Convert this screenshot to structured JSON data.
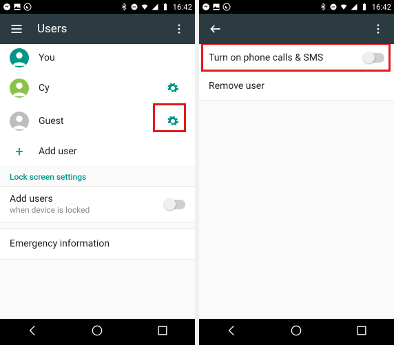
{
  "status": {
    "time": "16:42"
  },
  "left": {
    "title": "Users",
    "users": {
      "you": "You",
      "cy": "Cy",
      "guest": "Guest",
      "add": "Add user"
    },
    "section_lock": "Lock screen settings",
    "adduser_setting": {
      "primary": "Add users",
      "secondary": "when device is locked"
    },
    "emergency": "Emergency information"
  },
  "right": {
    "toggle_label": "Turn on phone calls & SMS",
    "remove_user": "Remove user"
  }
}
